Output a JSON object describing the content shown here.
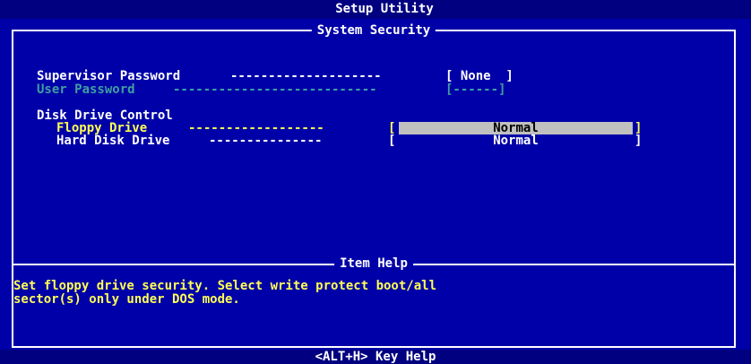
{
  "header": {
    "title": "Setup Utility"
  },
  "panel": {
    "title": "System Security"
  },
  "items": {
    "supervisor": {
      "label": "Supervisor Password",
      "dashes": "--------------------",
      "value": "[ None  ]"
    },
    "user": {
      "label": "User Password",
      "dashes": "---------------------------",
      "value": "[------]"
    },
    "disk_group": {
      "label": "Disk Drive Control"
    },
    "floppy": {
      "label": "Floppy Drive",
      "dashes": "------------------",
      "value": "Normal"
    },
    "hdd": {
      "label": "Hard Disk Drive",
      "dashes": "---------------",
      "value": "Normal"
    }
  },
  "brackets": {
    "open": "[",
    "close": "]"
  },
  "help": {
    "title": "Item Help",
    "line1": "Set floppy drive security. Select write protect boot/all",
    "line2": "sector(s) only under DOS mode."
  },
  "footer": {
    "hint": "<ALT+H>  Key Help"
  },
  "colors": {
    "background": "#0000a8",
    "title_bar": "#000080",
    "text_white": "#ffffff",
    "text_yellow": "#ffff54",
    "text_disabled": "#3fa0a0",
    "highlight": "#c0c0c0"
  }
}
